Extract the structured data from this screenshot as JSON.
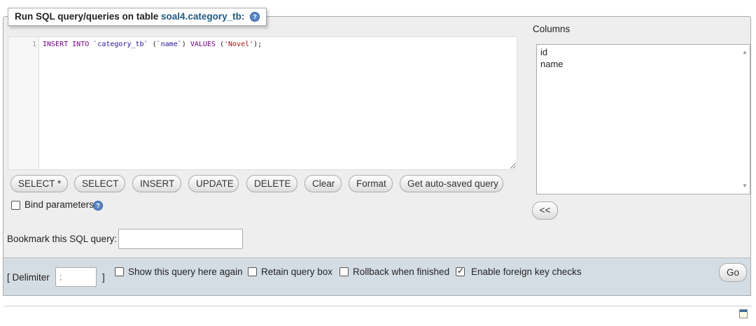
{
  "legend": {
    "prefix": "Run SQL query/queries on table ",
    "table": "soal4.category_tb:"
  },
  "editor": {
    "line_number": "1",
    "tokens": {
      "insert": "INSERT",
      "into": "INTO",
      "table": "`category_tb`",
      "col_open": "(",
      "col": "`name`",
      "col_close": ")",
      "values": "VALUES",
      "val_open": "(",
      "val": "'Novel'",
      "val_close": ");"
    }
  },
  "buttons": {
    "select_star": "SELECT *",
    "select": "SELECT",
    "insert": "INSERT",
    "update": "UPDATE",
    "delete": "DELETE",
    "clear": "Clear",
    "format": "Format",
    "get_autosaved": "Get auto-saved query"
  },
  "bind_parameters": {
    "label": "Bind parameters",
    "checked": false
  },
  "bookmark": {
    "label": "Bookmark this SQL query:",
    "value": ""
  },
  "columns": {
    "title": "Columns",
    "items": [
      "id",
      "name"
    ],
    "insert_button": "<<"
  },
  "bottom": {
    "delimiter_label_open": "[ Delimiter",
    "delimiter_placeholder": ";",
    "delimiter_label_close": "]",
    "show_query_again": {
      "label": "Show this query here again",
      "checked": false
    },
    "retain_query_box": {
      "label": "Retain query box",
      "checked": false
    },
    "rollback": {
      "label": "Rollback when finished",
      "checked": false
    },
    "foreign_key_checks": {
      "label": "Enable foreign key checks",
      "checked": true
    },
    "go": "Go"
  },
  "icons": {
    "help": "help-icon",
    "corner": "console-icon"
  }
}
